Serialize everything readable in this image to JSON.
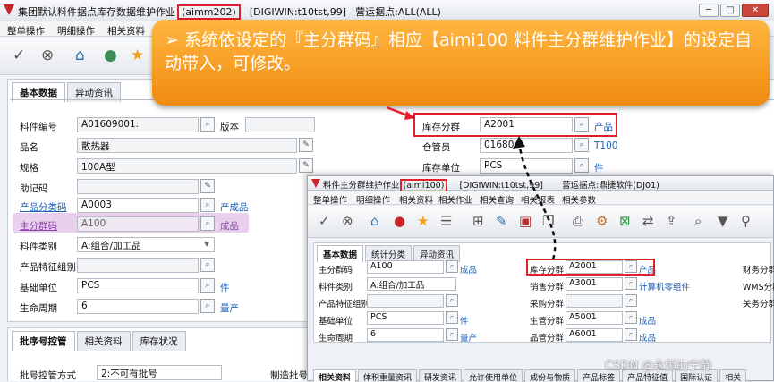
{
  "window": {
    "title_main": "集团默认料件据点库存数据维护作业",
    "title_code": "(aimm202)",
    "title_site": "[DIGIWIN:t10tst,99]",
    "title_org": "营运据点:ALL(ALL)",
    "btn_min": "─",
    "btn_max": "□",
    "btn_close": "✕"
  },
  "menu": {
    "items": [
      "整单操作",
      "明细操作",
      "相关资料"
    ]
  },
  "callout": {
    "text": "➢ 系统依设定的『主分群码』相应【aimi100 料件主分群维护作业】的设定自动带入，可修改。"
  },
  "main": {
    "tabs": [
      "基本数据",
      "异动资讯"
    ],
    "fields": {
      "item_no_label": "料件编号",
      "item_no": "A01609001.",
      "version_label": "版本",
      "name_label": "品名",
      "name": "散热器",
      "spec_label": "规格",
      "spec": "100A型",
      "mnemonic_label": "助记码",
      "mnemonic": "",
      "category_label": "产品分类码",
      "category": "A0003",
      "category_desc": "产成品",
      "main_group_label": "主分群码",
      "main_group": "A100",
      "main_group_desc": "成品",
      "item_type_label": "料件类别",
      "item_type": "A:组合/加工品",
      "feature_group_label": "产品特征组别",
      "feature_group": "",
      "base_unit_label": "基础单位",
      "base_unit": "PCS",
      "base_unit_desc": "件",
      "lifecycle_label": "生命周期",
      "lifecycle": "6",
      "lifecycle_desc": "量产"
    },
    "right": {
      "stock_group_label": "库存分群",
      "stock_group": "A2001",
      "stock_group_desc": "产品",
      "keeper_label": "仓管员",
      "keeper": "01680",
      "keeper_desc": "T100",
      "stock_unit_label": "库存单位",
      "stock_unit": "PCS",
      "stock_unit_desc": "件"
    },
    "bottom_tabs": [
      "批序号控管",
      "相关资料",
      "库存状况"
    ],
    "bottom": {
      "lot_ctrl_label": "批号控管方式",
      "lot_ctrl": "2:不可有批号",
      "mfg_lot_label": "制造批号"
    }
  },
  "sub": {
    "title": "料件主分群维护作业",
    "title_code": "(aimi100)",
    "title_site": "[DIGIWIN:t10tst,99]",
    "title_org": "营运据点:鼎捷软件(DJ01)",
    "menu": [
      "整单操作",
      "明细操作",
      "相关资料",
      "相关作业",
      "相关查询",
      "相关报表",
      "相关参数"
    ],
    "tabs": [
      "基本数据",
      "统计分类",
      "异动资讯"
    ],
    "left": [
      {
        "label": "主分群码",
        "value": "A100",
        "desc": "成品"
      },
      {
        "label": "料件类别",
        "value": "A:组合/加工品",
        "desc": ""
      },
      {
        "label": "产品特征组别",
        "value": "",
        "desc": ""
      },
      {
        "label": "基础单位",
        "value": "PCS",
        "desc": "件"
      },
      {
        "label": "生命周期",
        "value": "6",
        "desc": "量产"
      }
    ],
    "mid": [
      {
        "label": "库存分群",
        "value": "A2001",
        "desc": "产品"
      },
      {
        "label": "销售分群",
        "value": "A3001",
        "desc": "计算机零组件"
      },
      {
        "label": "采购分群",
        "value": "",
        "desc": ""
      },
      {
        "label": "生管分群",
        "value": "A5001",
        "desc": "成品"
      },
      {
        "label": "品管分群",
        "value": "A6001",
        "desc": "成品"
      }
    ],
    "far": [
      "财务分群",
      "WMS分群",
      "关务分群"
    ],
    "bottom_tabs": [
      "相关资料",
      "体积重量资讯",
      "研发资讯",
      "允许使用单位",
      "成份与物质",
      "产品标签",
      "产品特征值",
      "国际认证",
      "相关"
    ]
  },
  "watermark": {
    "text": "CSDN @永恒的宁静"
  }
}
